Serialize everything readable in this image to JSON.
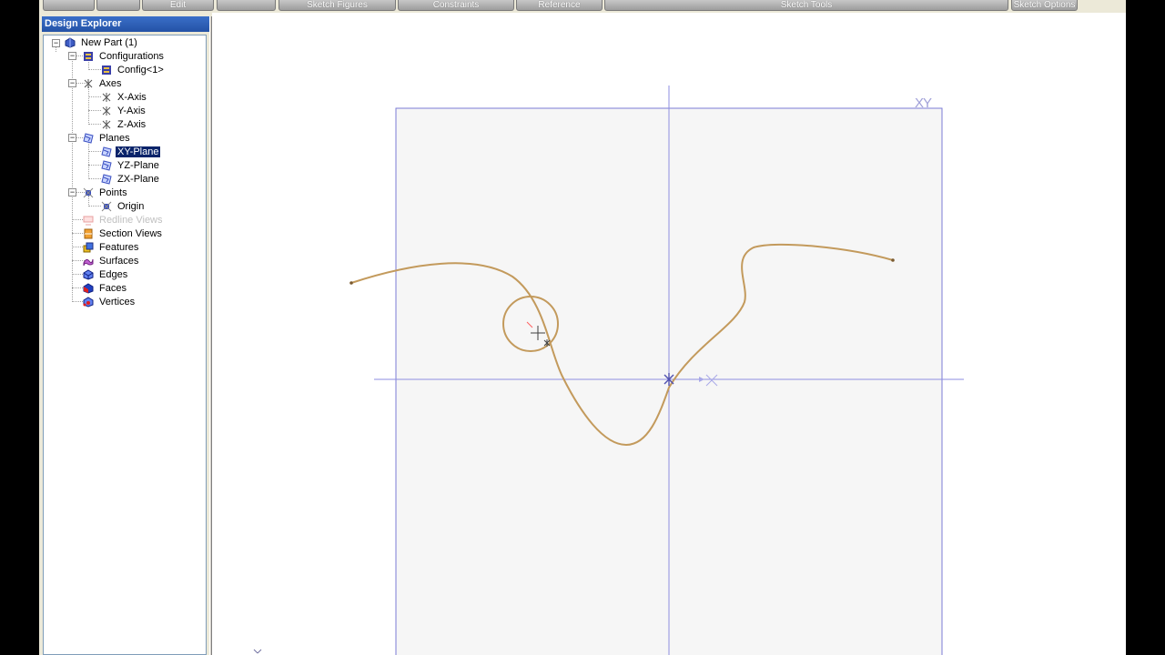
{
  "toolbar": {
    "buttons": [
      "",
      "",
      "Edit",
      "",
      "Sketch Figures",
      "Constraints",
      "Reference",
      "Sketch Tools",
      "Sketch Options"
    ]
  },
  "explorer": {
    "title": "Design Explorer",
    "items": [
      {
        "label": "New Part (1)",
        "icon": "part-icon"
      },
      {
        "label": "Configurations",
        "icon": "configurations-icon"
      },
      {
        "label": "Config<1>",
        "icon": "config-icon"
      },
      {
        "label": "Axes",
        "icon": "axes-icon"
      },
      {
        "label": "X-Axis",
        "icon": "axis-icon"
      },
      {
        "label": "Y-Axis",
        "icon": "axis-icon"
      },
      {
        "label": "Z-Axis",
        "icon": "axis-icon"
      },
      {
        "label": "Planes",
        "icon": "planes-icon"
      },
      {
        "label": "XY-Plane",
        "icon": "plane-icon",
        "selected": true
      },
      {
        "label": "YZ-Plane",
        "icon": "plane-icon"
      },
      {
        "label": "ZX-Plane",
        "icon": "plane-icon"
      },
      {
        "label": "Points",
        "icon": "points-icon"
      },
      {
        "label": "Origin",
        "icon": "origin-icon"
      },
      {
        "label": "Redline Views",
        "icon": "redline-views-icon",
        "disabled": true
      },
      {
        "label": "Section Views",
        "icon": "section-views-icon"
      },
      {
        "label": "Features",
        "icon": "features-icon"
      },
      {
        "label": "Surfaces",
        "icon": "surfaces-icon"
      },
      {
        "label": "Edges",
        "icon": "edges-icon"
      },
      {
        "label": "Faces",
        "icon": "faces-icon"
      },
      {
        "label": "Vertices",
        "icon": "vertices-icon"
      }
    ]
  },
  "sketch": {
    "plane_label": "XY",
    "colors": {
      "axis": "#8e8ee0",
      "plane_border": "#7b7bd6",
      "plane_fill": "#f6f6f6",
      "spline": "#c39a5c",
      "highlight": "#ff6060",
      "selected_bg": "#0a246a",
      "title_bar": "#2d5fb8"
    }
  }
}
